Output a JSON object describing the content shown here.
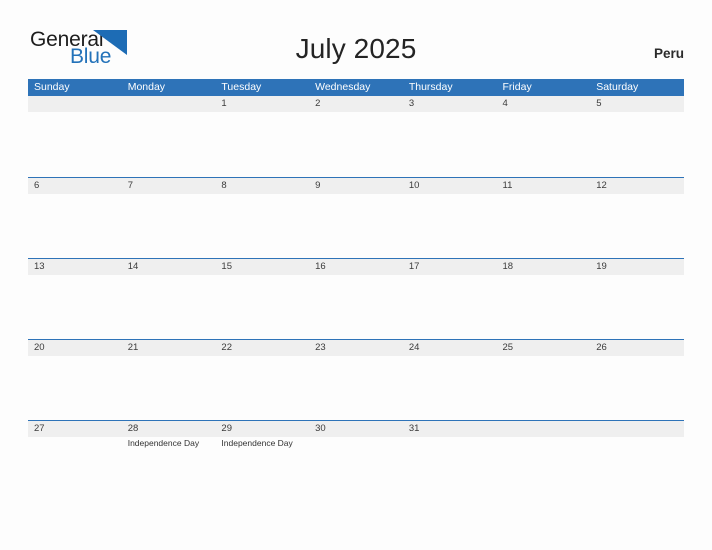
{
  "brand": {
    "name_part1": "General",
    "name_part2": "Blue",
    "mark": "triangle-flag-mark",
    "color_dark": "#1d1d1d",
    "color_blue": "#2372b9"
  },
  "header": {
    "title": "July 2025",
    "country": "Peru"
  },
  "theme": {
    "header_blue": "#2e73b8",
    "band_gray": "#efefef",
    "page_background": "#fdfdfd",
    "text_dark": "#3b3b3b"
  },
  "calendar": {
    "month": "July",
    "year": "2025",
    "weekday_headers": [
      "Sunday",
      "Monday",
      "Tuesday",
      "Wednesday",
      "Thursday",
      "Friday",
      "Saturday"
    ],
    "weeks": [
      {
        "days": [
          {
            "num": "",
            "event": ""
          },
          {
            "num": "",
            "event": ""
          },
          {
            "num": "1",
            "event": ""
          },
          {
            "num": "2",
            "event": ""
          },
          {
            "num": "3",
            "event": ""
          },
          {
            "num": "4",
            "event": ""
          },
          {
            "num": "5",
            "event": ""
          }
        ]
      },
      {
        "days": [
          {
            "num": "6",
            "event": ""
          },
          {
            "num": "7",
            "event": ""
          },
          {
            "num": "8",
            "event": ""
          },
          {
            "num": "9",
            "event": ""
          },
          {
            "num": "10",
            "event": ""
          },
          {
            "num": "11",
            "event": ""
          },
          {
            "num": "12",
            "event": ""
          }
        ]
      },
      {
        "days": [
          {
            "num": "13",
            "event": ""
          },
          {
            "num": "14",
            "event": ""
          },
          {
            "num": "15",
            "event": ""
          },
          {
            "num": "16",
            "event": ""
          },
          {
            "num": "17",
            "event": ""
          },
          {
            "num": "18",
            "event": ""
          },
          {
            "num": "19",
            "event": ""
          }
        ]
      },
      {
        "days": [
          {
            "num": "20",
            "event": ""
          },
          {
            "num": "21",
            "event": ""
          },
          {
            "num": "22",
            "event": ""
          },
          {
            "num": "23",
            "event": ""
          },
          {
            "num": "24",
            "event": ""
          },
          {
            "num": "25",
            "event": ""
          },
          {
            "num": "26",
            "event": ""
          }
        ]
      },
      {
        "days": [
          {
            "num": "27",
            "event": ""
          },
          {
            "num": "28",
            "event": "Independence Day"
          },
          {
            "num": "29",
            "event": "Independence Day"
          },
          {
            "num": "30",
            "event": ""
          },
          {
            "num": "31",
            "event": ""
          },
          {
            "num": "",
            "event": ""
          },
          {
            "num": "",
            "event": ""
          }
        ]
      }
    ]
  }
}
